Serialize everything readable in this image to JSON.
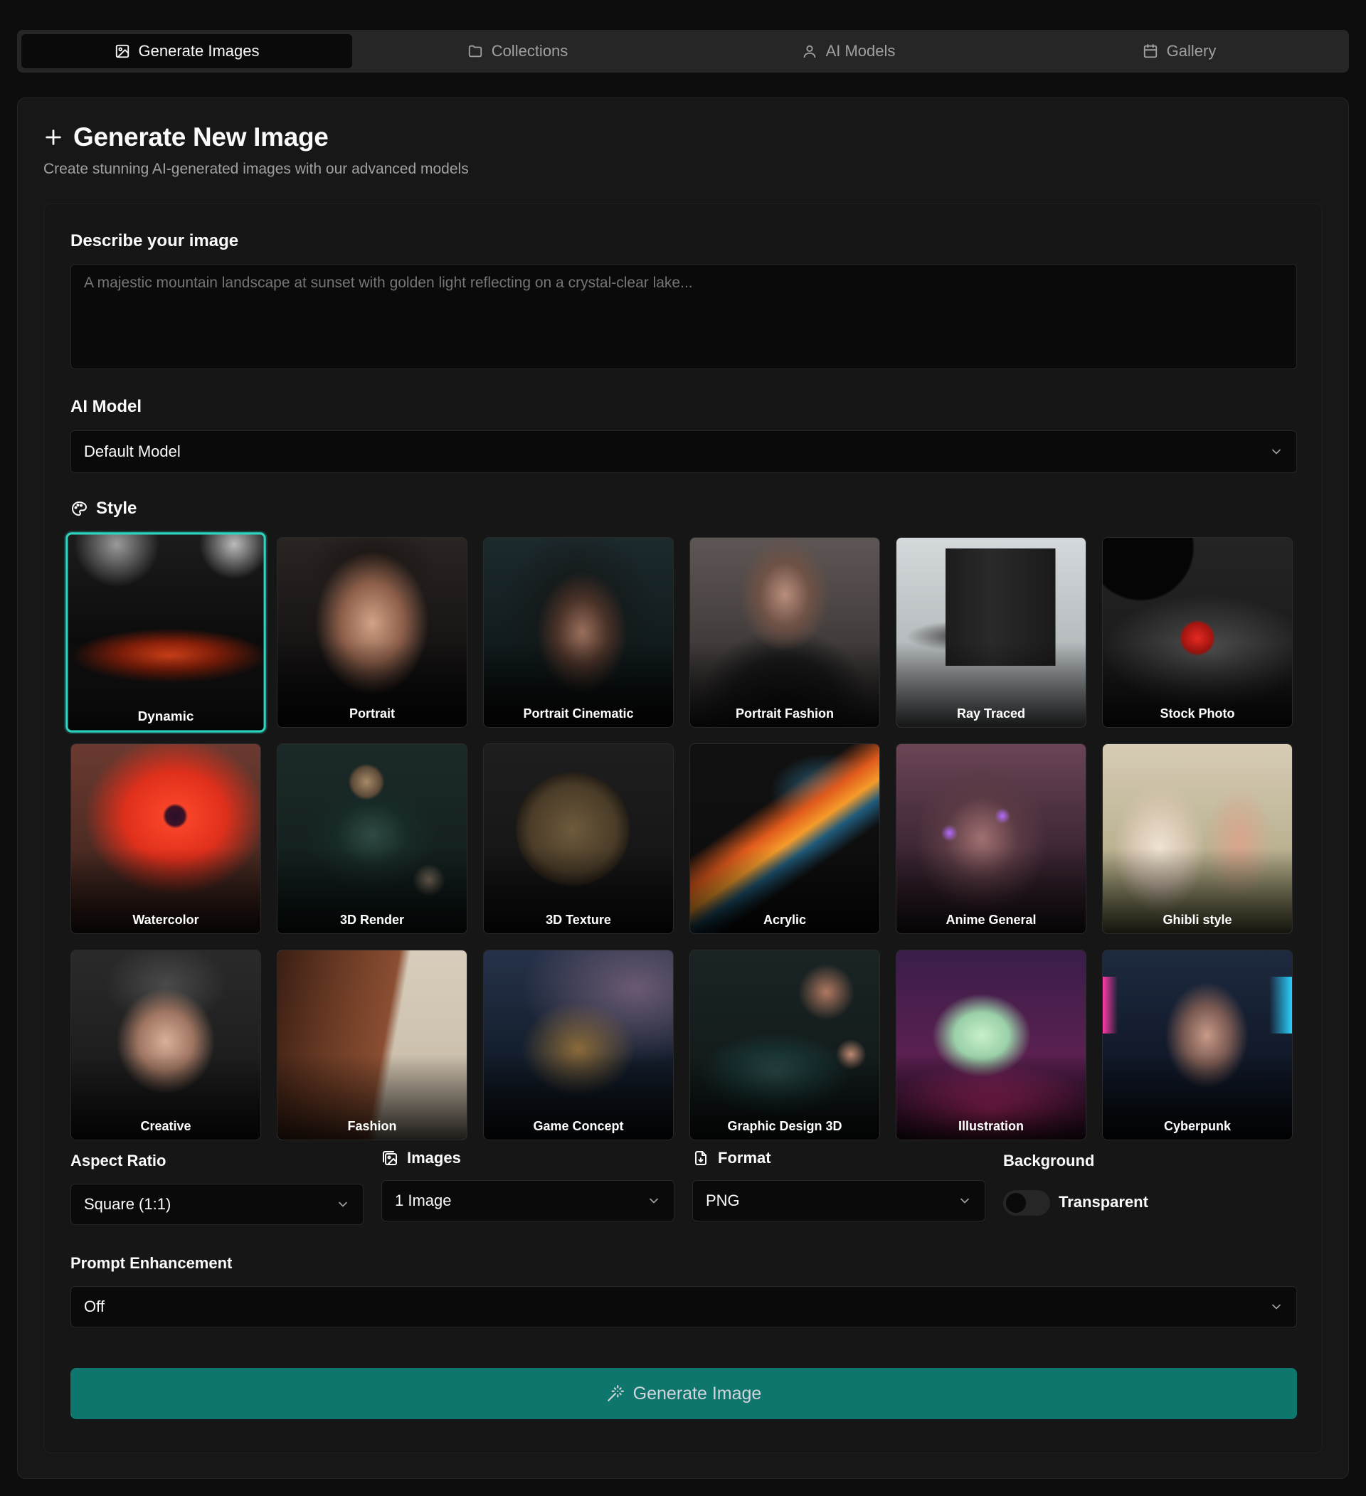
{
  "tabs": [
    {
      "label": "Generate Images",
      "icon": "image-icon",
      "active": true
    },
    {
      "label": "Collections",
      "icon": "folder-icon",
      "active": false
    },
    {
      "label": "AI Models",
      "icon": "user-icon",
      "active": false
    },
    {
      "label": "Gallery",
      "icon": "calendar-icon",
      "active": false
    }
  ],
  "header": {
    "title": "Generate New Image",
    "subtitle": "Create stunning AI-generated images with our advanced models"
  },
  "prompt": {
    "label": "Describe your image",
    "placeholder": "A majestic mountain landscape at sunset with golden light reflecting on a crystal-clear lake..."
  },
  "model": {
    "label": "AI Model",
    "value": "Default Model"
  },
  "style": {
    "label": "Style",
    "selected": "Dynamic",
    "items": [
      {
        "name": "Dynamic"
      },
      {
        "name": "Portrait"
      },
      {
        "name": "Portrait Cinematic"
      },
      {
        "name": "Portrait Fashion"
      },
      {
        "name": "Ray Traced"
      },
      {
        "name": "Stock Photo"
      },
      {
        "name": "Watercolor"
      },
      {
        "name": "3D Render"
      },
      {
        "name": "3D Texture"
      },
      {
        "name": "Acrylic"
      },
      {
        "name": "Anime General"
      },
      {
        "name": "Ghibli style"
      },
      {
        "name": "Creative"
      },
      {
        "name": "Fashion"
      },
      {
        "name": "Game Concept"
      },
      {
        "name": "Graphic Design 3D"
      },
      {
        "name": "Illustration"
      },
      {
        "name": "Cyberpunk"
      }
    ]
  },
  "options": {
    "aspect_ratio": {
      "label": "Aspect Ratio",
      "value": "Square (1:1)"
    },
    "images": {
      "label": "Images",
      "value": "1 Image"
    },
    "format": {
      "label": "Format",
      "value": "PNG"
    },
    "background": {
      "label": "Background",
      "toggle_label": "Transparent",
      "enabled": false
    }
  },
  "enhancement": {
    "label": "Prompt Enhancement",
    "value": "Off"
  },
  "generate_button": {
    "label": "Generate Image"
  },
  "colors": {
    "accent": "#2dd4bf",
    "button": "#0f766e",
    "background": "#0d0d0d",
    "card": "#171717"
  }
}
